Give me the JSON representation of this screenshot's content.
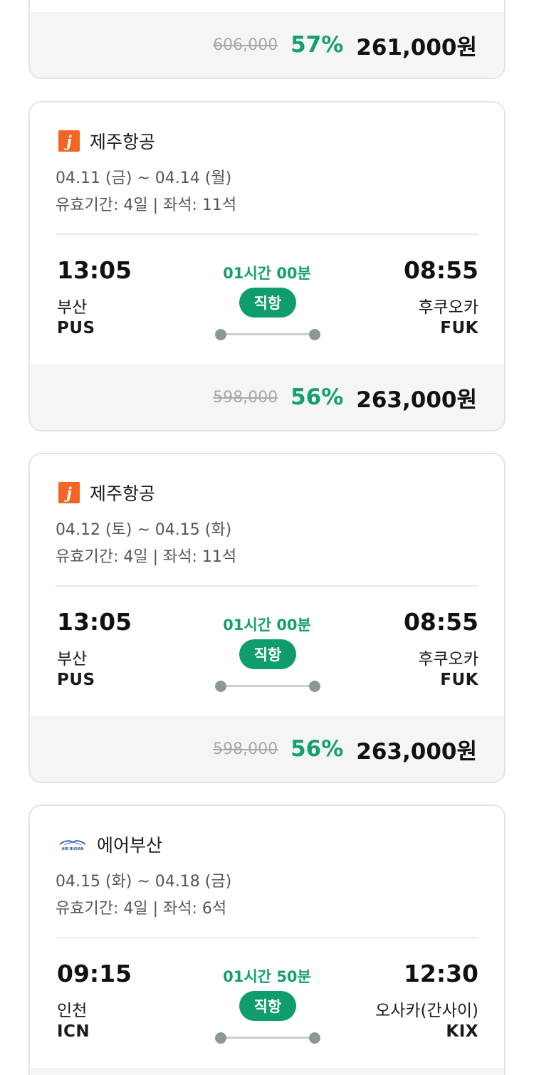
{
  "colors": {
    "accent": "#14a06b",
    "badge": "#0f9d6b",
    "jeju_brand": "#f26522",
    "airbusan_brand": "#1f4e9b"
  },
  "top_partial": {
    "original_price": "606,000",
    "discount": "57%",
    "final_price": "261,000원"
  },
  "cards": [
    {
      "airline": "제주항공",
      "logo_icon": "jeju-air-logo-icon",
      "logo_glyph": "j",
      "dates": "04.11 (금) ~ 04.14 (월)",
      "validity": "유효기간: 4일 | 좌석: 11석",
      "dep_time": "13:05",
      "dep_city": "부산",
      "dep_code": "PUS",
      "duration": "01시간 00분",
      "badge": "직항",
      "arr_time": "08:55",
      "arr_city": "후쿠오카",
      "arr_code": "FUK",
      "original_price": "598,000",
      "discount": "56%",
      "final_price": "263,000원"
    },
    {
      "airline": "제주항공",
      "logo_icon": "jeju-air-logo-icon",
      "logo_glyph": "j",
      "dates": "04.12 (토) ~ 04.15 (화)",
      "validity": "유효기간: 4일 | 좌석: 11석",
      "dep_time": "13:05",
      "dep_city": "부산",
      "dep_code": "PUS",
      "duration": "01시간 00분",
      "badge": "직항",
      "arr_time": "08:55",
      "arr_city": "후쿠오카",
      "arr_code": "FUK",
      "original_price": "598,000",
      "discount": "56%",
      "final_price": "263,000원"
    },
    {
      "airline": "에어부산",
      "logo_icon": "air-busan-logo-icon",
      "logo_glyph": "AIR BUSAN",
      "dates": "04.15 (화) ~ 04.18 (금)",
      "validity": "유효기간: 4일 | 좌석: 6석",
      "dep_time": "09:15",
      "dep_city": "인천",
      "dep_code": "ICN",
      "duration": "01시간 50분",
      "badge": "직항",
      "arr_time": "12:30",
      "arr_city": "오사카(간사이)",
      "arr_code": "KIX"
    }
  ]
}
